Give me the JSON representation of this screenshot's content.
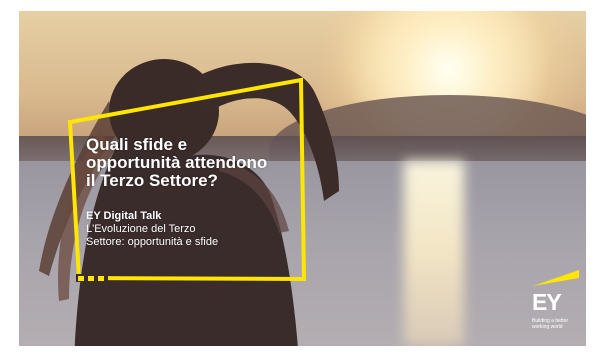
{
  "slide": {
    "headline_lines": [
      "Quali sfide e",
      "opportunità attendono",
      "il Terzo Settore?"
    ],
    "subtitle_lines": [
      "EY Digital Talk",
      "L'Evoluzione del Terzo",
      "Settore: opportunità e sfide"
    ]
  },
  "logo": {
    "mark": "EY",
    "tagline_lines": [
      "Building a better",
      "working world"
    ]
  },
  "colors": {
    "accent_yellow": "#ffe600",
    "text": "#ffffff"
  },
  "icons": {
    "logo_beam": "ey-beam-icon"
  }
}
